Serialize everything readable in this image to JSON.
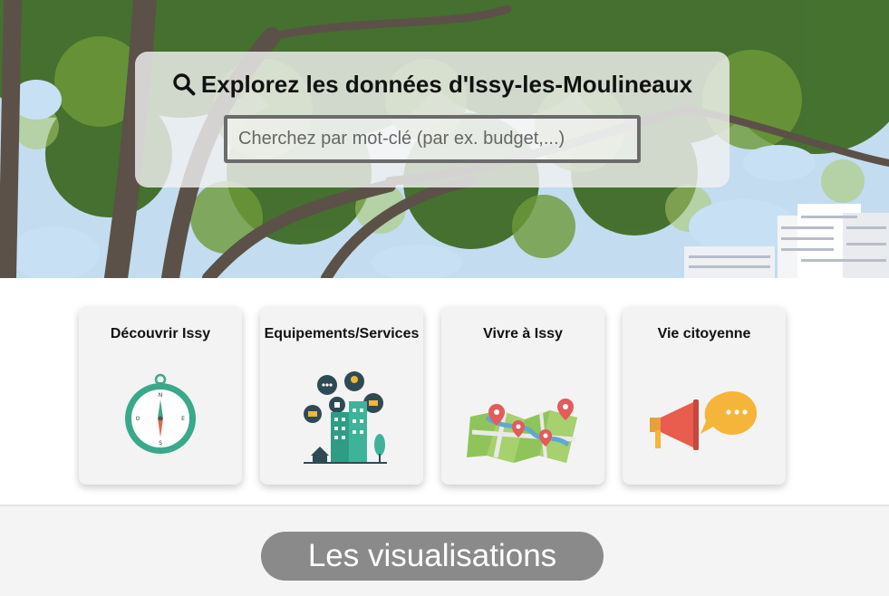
{
  "hero": {
    "title": "Explorez les données d'Issy-les-Moulineaux",
    "search_placeholder": "Cherchez par mot-clé (par ex. budget,...)",
    "search_icon": "search-icon"
  },
  "categories": [
    {
      "label": "Découvrir Issy",
      "icon": "compass-icon"
    },
    {
      "label": "Equipements/Services",
      "icon": "city-services-icon"
    },
    {
      "label": "Vivre à Issy",
      "icon": "map-pins-icon"
    },
    {
      "label": "Vie citoyenne",
      "icon": "megaphone-speech-icon"
    }
  ],
  "visualisations": {
    "label": "Les visualisations"
  },
  "colors": {
    "panel": "#f0f0f0",
    "card": "#f3f3f3",
    "button": "#8a8a8a",
    "compass": "#3aa88a",
    "map_pin": "#e35b5b",
    "megaphone": "#e85d4e",
    "bubble": "#f4b53a"
  }
}
